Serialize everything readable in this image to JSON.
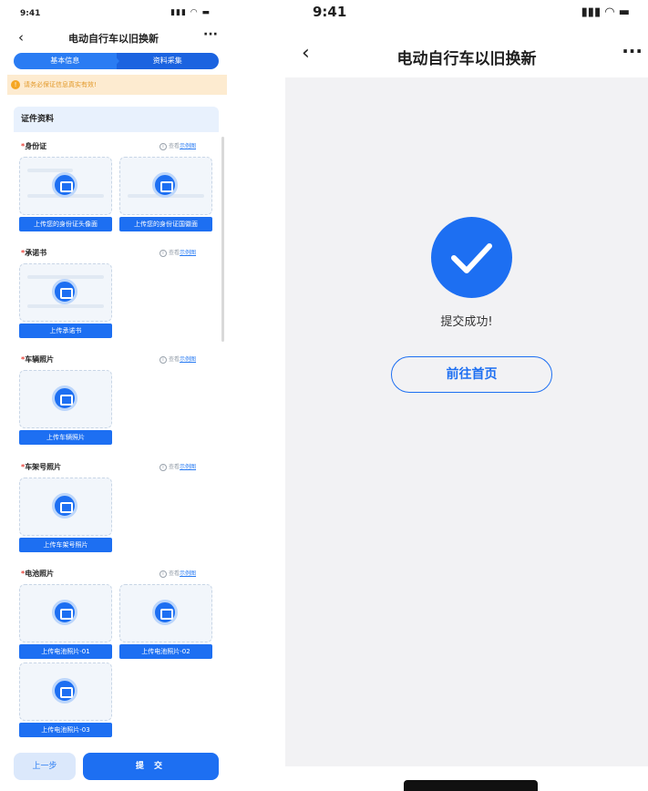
{
  "left": {
    "status_time": "9:41",
    "status_icons": "..ıl ᯤ ▬",
    "nav_title": "电动自行车以旧换新",
    "steps": [
      "基本信息",
      "资料采集"
    ],
    "notice": "请务必保证信息真实有效!",
    "card_title": "证件资料",
    "sections": [
      {
        "title": "身份证",
        "example_prefix": "查看",
        "example_link": "示例图",
        "buttons": [
          "上传您的身份证头像面",
          "上传您的身份证国徽面"
        ]
      },
      {
        "title": "承诺书",
        "example_prefix": "查看",
        "example_link": "示例图",
        "buttons": [
          "上传承诺书"
        ]
      },
      {
        "title": "车辆照片",
        "example_prefix": "查看",
        "example_link": "示例图",
        "buttons": [
          "上传车辆照片"
        ]
      },
      {
        "title": "车架号照片",
        "example_prefix": "查看",
        "example_link": "示例图",
        "buttons": [
          "上传车架号照片"
        ]
      },
      {
        "title": "电池照片",
        "example_prefix": "查看",
        "example_link": "示例图",
        "buttons": [
          "上传电池照片-01",
          "上传电池照片-02",
          "上传电池照片-03"
        ]
      }
    ],
    "prev_label": "上一步",
    "submit_label": "提 交"
  },
  "right": {
    "status_time": "9:41",
    "nav_title": "电动自行车以旧换新",
    "success_text": "提交成功!",
    "home_button": "前往首页"
  },
  "colors": {
    "accent": "#1d6ff2",
    "notice_bg": "#fdebd0",
    "required": "#e8453c"
  }
}
